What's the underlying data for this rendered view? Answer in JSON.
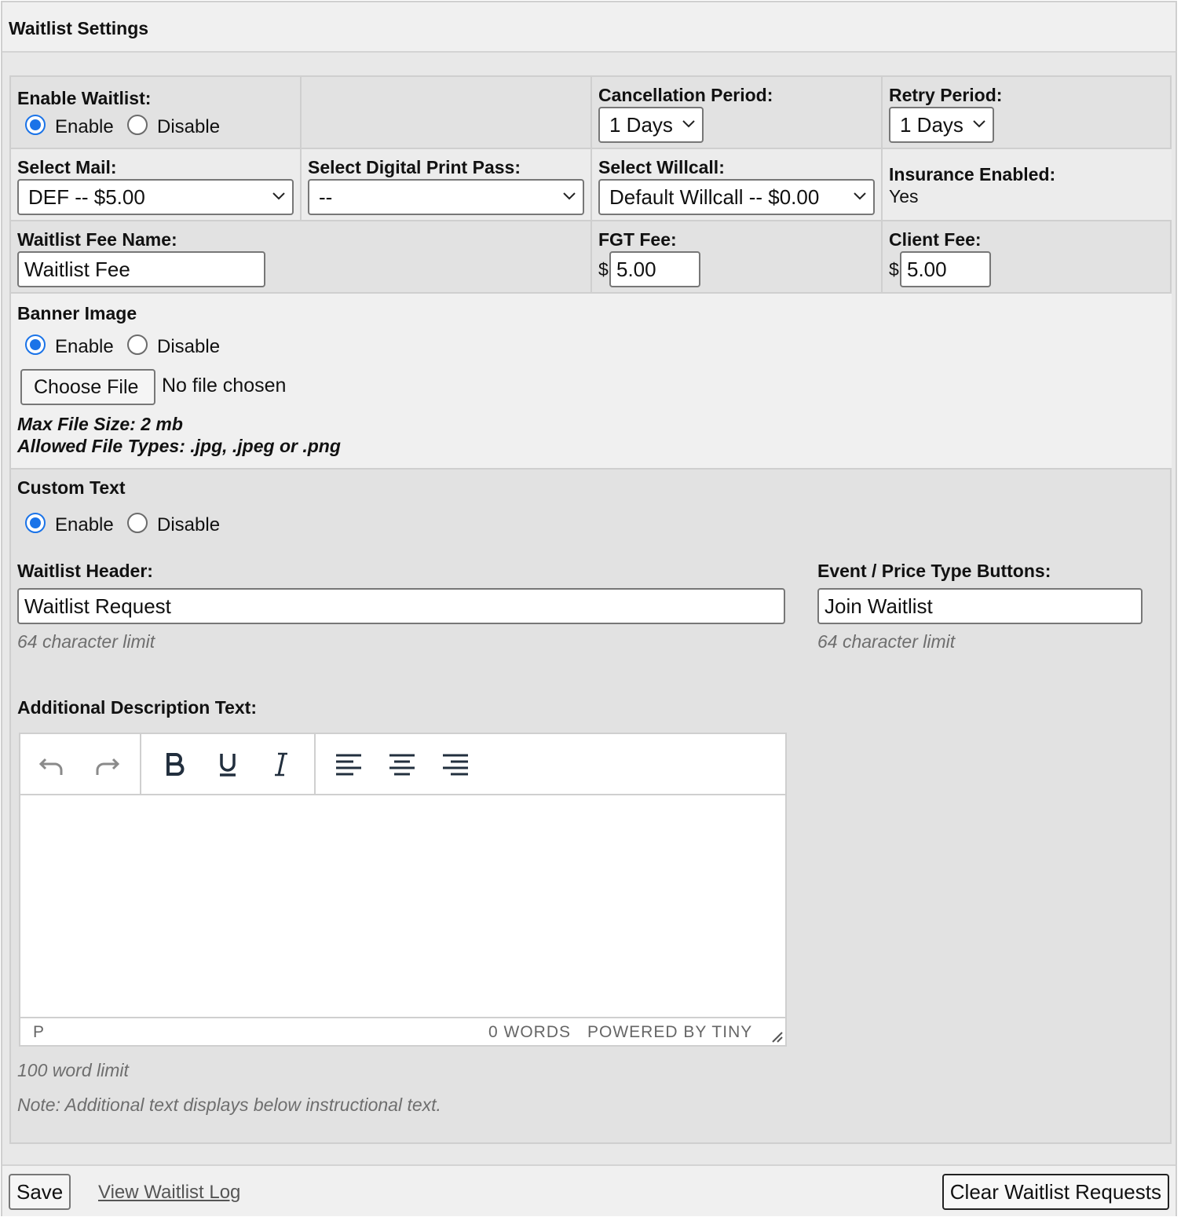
{
  "panel": {
    "title": "Waitlist Settings"
  },
  "enable_waitlist": {
    "label": "Enable Waitlist:",
    "enable": "Enable",
    "disable": "Disable",
    "selected": "Enable"
  },
  "cancellation": {
    "label": "Cancellation Period:",
    "value": "1 Days"
  },
  "retry": {
    "label": "Retry Period:",
    "value": "1 Days"
  },
  "mail": {
    "label": "Select Mail:",
    "value": "DEF -- $5.00"
  },
  "print_pass": {
    "label": "Select Digital Print Pass:",
    "value": "--"
  },
  "willcall": {
    "label": "Select Willcall:",
    "value": "Default Willcall -- $0.00"
  },
  "insurance": {
    "label": "Insurance Enabled:",
    "value": "Yes"
  },
  "fee_name": {
    "label": "Waitlist Fee Name:",
    "value": "Waitlist Fee"
  },
  "fgt_fee": {
    "label": "FGT Fee:",
    "currency": "$",
    "value": "5.00"
  },
  "client_fee": {
    "label": "Client Fee:",
    "currency": "$",
    "value": "5.00"
  },
  "banner": {
    "label": "Banner Image",
    "enable": "Enable",
    "disable": "Disable",
    "selected": "Enable",
    "choose_file": "Choose File",
    "file_status": "No file chosen",
    "max_size": "Max File Size: 2 mb",
    "allowed_types": "Allowed File Types: .jpg, .jpeg or .png"
  },
  "custom_text": {
    "label": "Custom Text",
    "enable": "Enable",
    "disable": "Disable",
    "selected": "Enable",
    "header_label": "Waitlist Header:",
    "header_value": "Waitlist Request",
    "header_hint": "64 character limit",
    "buttons_label": "Event / Price Type Buttons:",
    "buttons_value": "Join Waitlist",
    "buttons_hint": "64 character limit",
    "description_label": "Additional Description Text:",
    "editor": {
      "toolbar": [
        "undo-icon",
        "redo-icon",
        "bold-icon",
        "underline-icon",
        "italic-icon",
        "align-left-icon",
        "align-center-icon",
        "align-right-icon"
      ],
      "path": "P",
      "word_count": "0 WORDS",
      "powered_by": "POWERED BY TINY"
    },
    "word_limit": "100 word limit",
    "note": "Note: Additional text displays below instructional text."
  },
  "footer": {
    "save": "Save",
    "view_log": "View Waitlist Log",
    "clear": "Clear Waitlist Requests"
  },
  "colors": {
    "accent": "#1a73e8",
    "panel_bg": "#e2e2e2",
    "header_bg": "#f0f0f0"
  }
}
